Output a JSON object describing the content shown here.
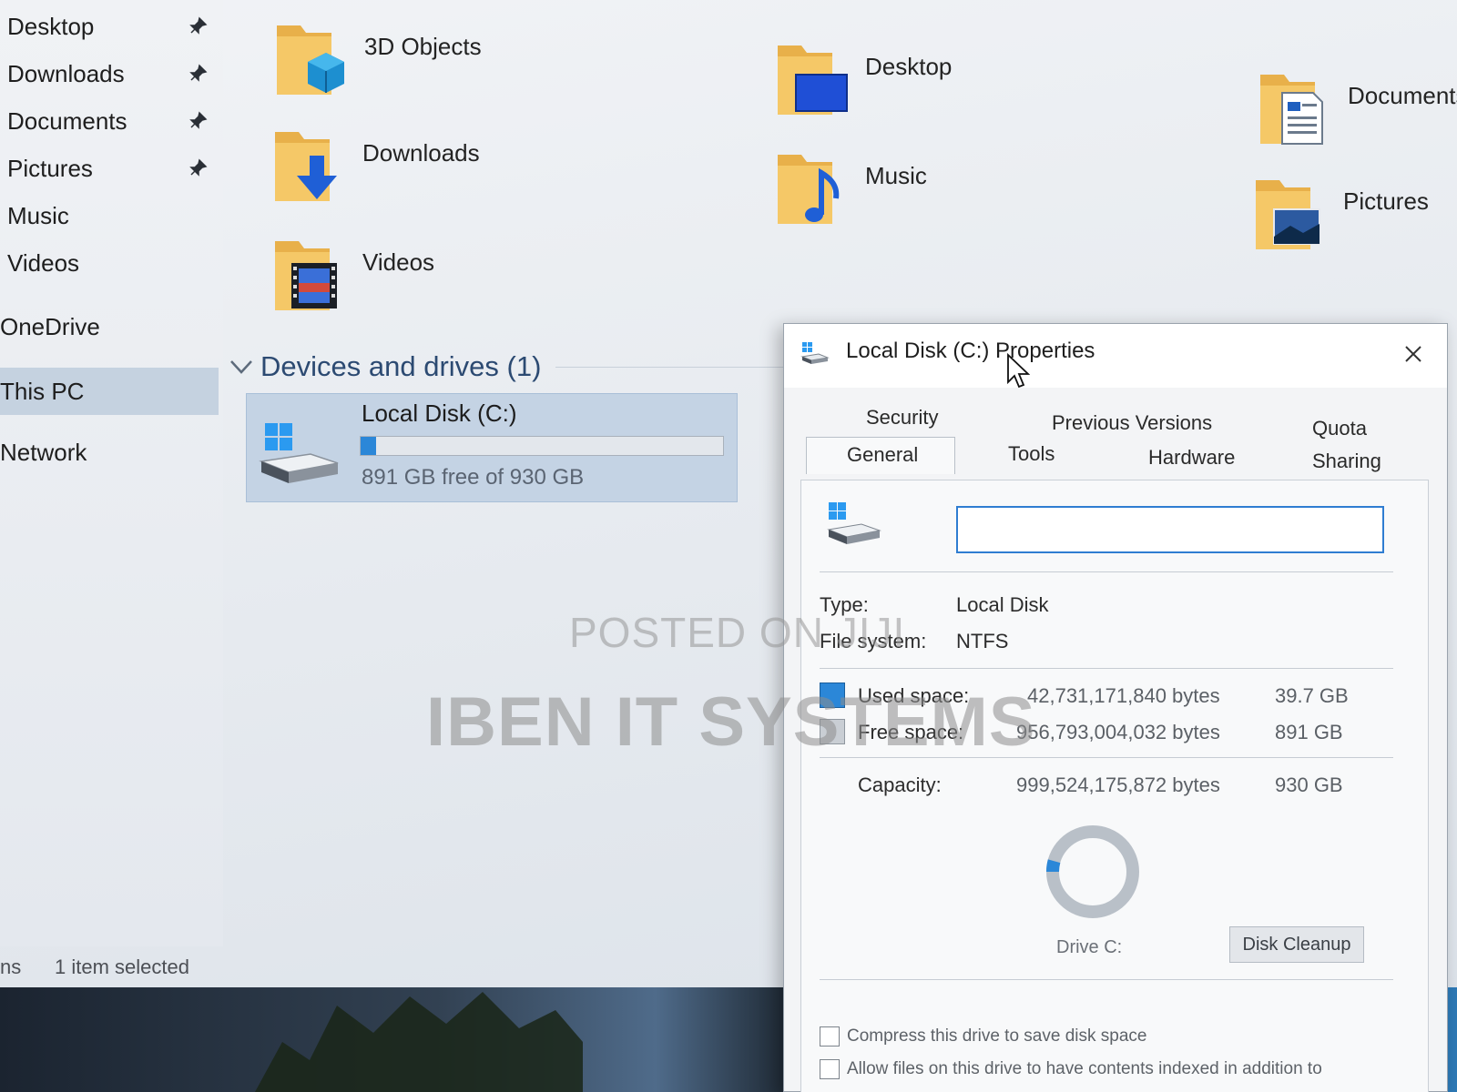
{
  "nav_pane": {
    "items": [
      {
        "label": "Desktop",
        "pinned": true
      },
      {
        "label": "Downloads",
        "pinned": true
      },
      {
        "label": "Documents",
        "pinned": true
      },
      {
        "label": "Pictures",
        "pinned": true
      },
      {
        "label": "Music",
        "pinned": false
      },
      {
        "label": "Videos",
        "pinned": false
      },
      {
        "label": "OneDrive",
        "pinned": false
      },
      {
        "label": "This PC",
        "pinned": false,
        "selected": true
      },
      {
        "label": "Network",
        "pinned": false
      }
    ]
  },
  "folders": [
    {
      "label": "3D Objects",
      "icon": "folder-3d-objects-icon"
    },
    {
      "label": "Desktop",
      "icon": "folder-desktop-icon"
    },
    {
      "label": "Documents",
      "icon": "folder-documents-icon"
    },
    {
      "label": "Downloads",
      "icon": "folder-downloads-icon"
    },
    {
      "label": "Music",
      "icon": "folder-music-icon"
    },
    {
      "label": "Pictures",
      "icon": "folder-pictures-icon"
    },
    {
      "label": "Videos",
      "icon": "folder-videos-icon"
    }
  ],
  "devices_section": {
    "title": "Devices and drives (1)"
  },
  "drive": {
    "name": "Local Disk (C:)",
    "free_text": "891 GB free of 930 GB",
    "used_fraction": 0.043
  },
  "status_bar": {
    "items_count": "ns",
    "selection": "1 item selected"
  },
  "properties_dialog": {
    "title": "Local Disk (C:) Properties",
    "tabs": {
      "security": "Security",
      "previous_versions": "Previous Versions",
      "quota": "Quota",
      "general": "General",
      "tools": "Tools",
      "hardware": "Hardware",
      "sharing": "Sharing"
    },
    "active_tab": "General",
    "label_value": "",
    "type_label": "Type:",
    "type_value": "Local Disk",
    "fs_label": "File system:",
    "fs_value": "NTFS",
    "used_label": "Used space:",
    "used_bytes": "42,731,171,840 bytes",
    "used_gb": "39.7 GB",
    "free_label": "Free space:",
    "free_bytes": "956,793,004,032 bytes",
    "free_gb": "891 GB",
    "capacity_label": "Capacity:",
    "capacity_bytes": "999,524,175,872 bytes",
    "capacity_gb": "930 GB",
    "used_fraction": 0.043,
    "drive_label": "Drive C:",
    "cleanup_label": "Disk Cleanup",
    "compress_label": "Compress this drive to save disk space",
    "index_label": "Allow files on this drive to have contents indexed in addition to"
  },
  "watermark": {
    "line1": "POSTED ON JIJI",
    "line2": "IBEN IT SYSTEMS"
  },
  "colors": {
    "accent": "#2b87d8",
    "selection": "#c4d3e4",
    "folder": "#e8b04a"
  }
}
